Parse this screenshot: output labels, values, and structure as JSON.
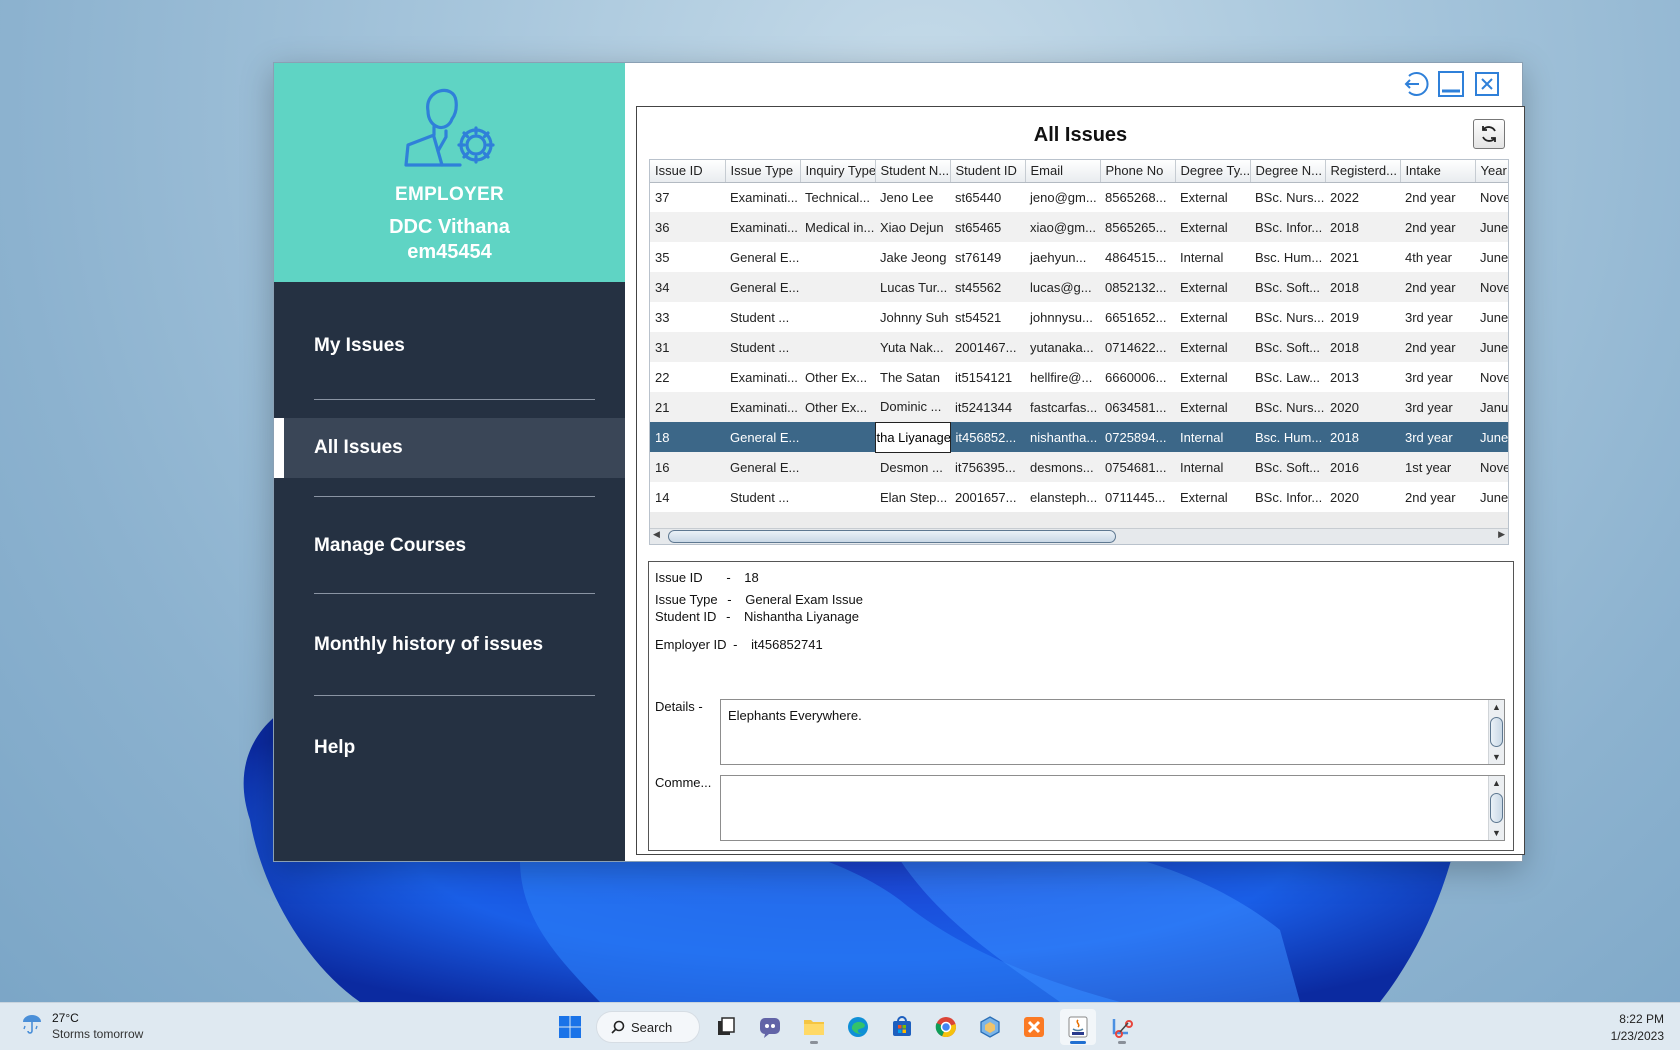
{
  "sidebar": {
    "role": "EMPLOYER",
    "name": "DDC Vithana",
    "employee_id": "em45454",
    "items": [
      {
        "label": "My Issues"
      },
      {
        "label": "All Issues"
      },
      {
        "label": "Manage Courses"
      },
      {
        "label": "Monthly history of issues"
      },
      {
        "label": "Help"
      }
    ]
  },
  "main": {
    "title": "All Issues",
    "columns": [
      "Issue ID",
      "Issue Type",
      "Inquiry Type",
      "Student N...",
      "Student ID",
      "Email",
      "Phone No",
      "Degree Ty...",
      "Degree N...",
      "Registerd...",
      "Intake",
      "Year"
    ],
    "rows": [
      [
        "37",
        "Examinati...",
        "Technical...",
        "Jeno Lee",
        "st65440",
        "jeno@gm...",
        "8565268...",
        "External",
        "BSc. Nurs...",
        "2022",
        "2nd year",
        "Nove"
      ],
      [
        "36",
        "Examinati...",
        "Medical in...",
        "Xiao Dejun",
        "st65465",
        "xiao@gm...",
        "8565265...",
        "External",
        "BSc. Infor...",
        "2018",
        "2nd year",
        "June"
      ],
      [
        "35",
        "General E...",
        "",
        "Jake Jeong",
        "st76149",
        "jaehyun...",
        "4864515...",
        "Internal",
        "Bsc. Hum...",
        "2021",
        "4th year",
        "June"
      ],
      [
        "34",
        "General E...",
        "",
        "Lucas Tur...",
        "st45562",
        "lucas@g...",
        "0852132...",
        "External",
        "BSc. Soft...",
        "2018",
        "2nd year",
        "Nove"
      ],
      [
        "33",
        "Student ...",
        "",
        "Johnny Suh",
        "st54521",
        "johnnysu...",
        "6651652...",
        "External",
        "BSc. Nurs...",
        "2019",
        "3rd year",
        "June"
      ],
      [
        "31",
        "Student ...",
        "",
        "Yuta Nak...",
        "2001467...",
        "yutanaka...",
        "0714622...",
        "External",
        "BSc. Soft...",
        "2018",
        "2nd year",
        "June"
      ],
      [
        "22",
        "Examinati...",
        "Other Ex...",
        "The Satan",
        "it5154121",
        "hellfire@...",
        "6660006...",
        "External",
        "BSc. Law...",
        "2013",
        "3rd year",
        "Nove"
      ],
      [
        "21",
        "Examinati...",
        "Other Ex...",
        "Dominic ...",
        "it5241344",
        "fastcarfas...",
        "0634581...",
        "External",
        "BSc. Nurs...",
        "2020",
        "3rd year",
        "Janua"
      ],
      [
        "18",
        "General E...",
        "",
        "tha Liyanage",
        "it456852...",
        "nishantha...",
        "0725894...",
        "Internal",
        "Bsc. Hum...",
        "2018",
        "3rd year",
        "June"
      ],
      [
        "16",
        "General E...",
        "",
        "Desmon ...",
        "it756395...",
        "desmons...",
        "0754681...",
        "Internal",
        "BSc. Soft...",
        "2016",
        "1st year",
        "Nove"
      ],
      [
        "14",
        "Student ...",
        "",
        "Elan Step...",
        "2001657...",
        "elansteph...",
        "0711445...",
        "External",
        "BSc. Infor...",
        "2020",
        "2nd year",
        "June"
      ]
    ],
    "selected_row_index": 8
  },
  "details": {
    "issue_id_label": "Issue ID",
    "issue_id_value": "18",
    "issue_type_label": "Issue Type",
    "issue_type_value": "General Exam Issue",
    "student_id_label": "Student ID",
    "student_id_value": "Nishantha Liyanage",
    "employer_id_label": "Employer ID",
    "employer_id_value": "it456852741",
    "details_label": "Details -",
    "details_value": "Elephants Everywhere.",
    "comments_label": "Comme...",
    "comments_value": "",
    "sep": "-"
  },
  "taskbar": {
    "temperature": "27°C",
    "weather": "Storms tomorrow",
    "search_label": "Search",
    "time": "8:22 PM",
    "date": "1/23/2023"
  },
  "colors": {
    "profile_bg": "#5fd4c4",
    "sidebar_bg": "#253142",
    "selected_row": "#3c6788",
    "accent_icon": "#2f80d9"
  }
}
